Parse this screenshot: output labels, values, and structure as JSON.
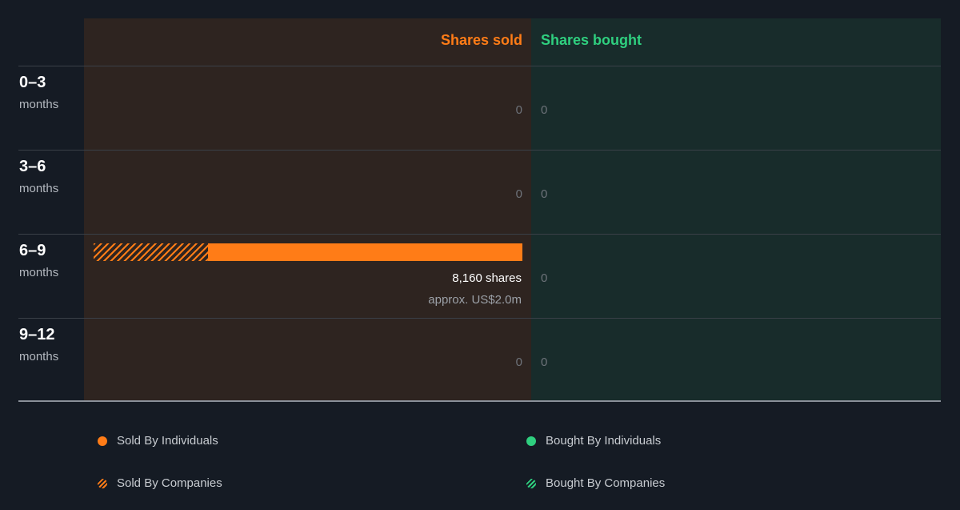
{
  "colors": {
    "sold": "#ff7c17",
    "bought": "#2fcf7f",
    "sold_panel": "#2e2420",
    "bought_panel": "#182c2b",
    "background": "#151b24"
  },
  "chart_data": {
    "type": "bar",
    "orientation": "horizontal",
    "headers": {
      "sold": "Shares sold",
      "bought": "Shares bought"
    },
    "categories": [
      {
        "range": "0–3",
        "unit": "months"
      },
      {
        "range": "3–6",
        "unit": "months"
      },
      {
        "range": "6–9",
        "unit": "months"
      },
      {
        "range": "9–12",
        "unit": "months"
      }
    ],
    "series": [
      {
        "name": "Sold By Individuals",
        "values": [
          0,
          0,
          5980,
          0
        ]
      },
      {
        "name": "Sold By Companies",
        "values": [
          0,
          0,
          2180,
          0
        ]
      },
      {
        "name": "Bought By Individuals",
        "values": [
          0,
          0,
          0,
          0
        ]
      },
      {
        "name": "Bought By Companies",
        "values": [
          0,
          0,
          0,
          0
        ]
      }
    ],
    "sold_totals": [
      "0",
      "0",
      "8,160 shares",
      "0"
    ],
    "bought_totals": [
      "0",
      "0",
      "0",
      "0"
    ],
    "sold_approx": [
      "",
      "",
      "approx. US$2.0m",
      ""
    ],
    "legend": [
      {
        "label": "Sold By Individuals",
        "style": "solid",
        "color": "#ff7c17"
      },
      {
        "label": "Bought By Individuals",
        "style": "solid",
        "color": "#2fcf7f"
      },
      {
        "label": "Sold By Companies",
        "style": "hatched",
        "color": "#ff7c17"
      },
      {
        "label": "Bought By Companies",
        "style": "hatched",
        "color": "#2fcf7f"
      }
    ]
  }
}
